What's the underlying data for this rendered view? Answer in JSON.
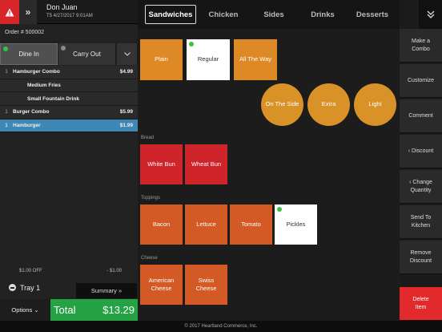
{
  "header": {
    "user_name": "Don Juan",
    "user_meta": "T5 4/27/2017 9:01AM",
    "order_number": "Order # 500002"
  },
  "order_type": {
    "dine_in": "Dine In",
    "carry_out": "Carry Out",
    "dine_in_status_color": "#3bbf4c",
    "carry_out_status_color": "#8a8a8a"
  },
  "order_items": [
    {
      "qty": "1",
      "name": "Hamburger Combo",
      "price": "$4.99"
    },
    {
      "qty": "",
      "name": "Medium Fries",
      "price": ""
    },
    {
      "qty": "",
      "name": "Small Fountain Drink",
      "price": ""
    },
    {
      "qty": "1",
      "name": "Burger Combo",
      "price": "$5.99"
    },
    {
      "qty": "1",
      "name": "Hamburger",
      "price": "$1.99"
    }
  ],
  "discount": {
    "label": "$1.00 OFF",
    "value": "- $1.00"
  },
  "tray": {
    "label": "Tray 1",
    "summary": "Summary »"
  },
  "options": {
    "label": "Options ⌄"
  },
  "total": {
    "label": "Total",
    "value": "$13.29"
  },
  "tabs": [
    {
      "label": "Sandwiches",
      "active": true
    },
    {
      "label": "Chicken"
    },
    {
      "label": "Sides"
    },
    {
      "label": "Drinks"
    },
    {
      "label": "Desserts"
    }
  ],
  "modifiers": {
    "doneness": [
      "Plain",
      "Regular",
      "All The Way"
    ],
    "amounts": [
      "On The Side",
      "Extra",
      "Light"
    ],
    "bread_label": "Bread",
    "bread": [
      "White Bun",
      "Wheat Bun"
    ],
    "toppings_label": "Toppings",
    "toppings": [
      "Bacon",
      "Lettuce",
      "Tomato",
      "Pickles"
    ],
    "cheese_label": "Cheese",
    "cheese": [
      "American Cheese",
      "Swiss Cheese"
    ]
  },
  "actions": [
    "Make a Combo",
    "Customize",
    "Comment",
    "‹ Discount",
    "‹ Change Quantity",
    "Send To Kitchen",
    "Remove Discount",
    "Delete Item"
  ],
  "footer": "© 2017 Heartland Commerce, Inc.",
  "colors": {
    "accent_selected_row": "#3f88b5",
    "total_green": "#24a244",
    "delete_red": "#e22a2d",
    "selected_indicator": "#3bbf4c"
  }
}
